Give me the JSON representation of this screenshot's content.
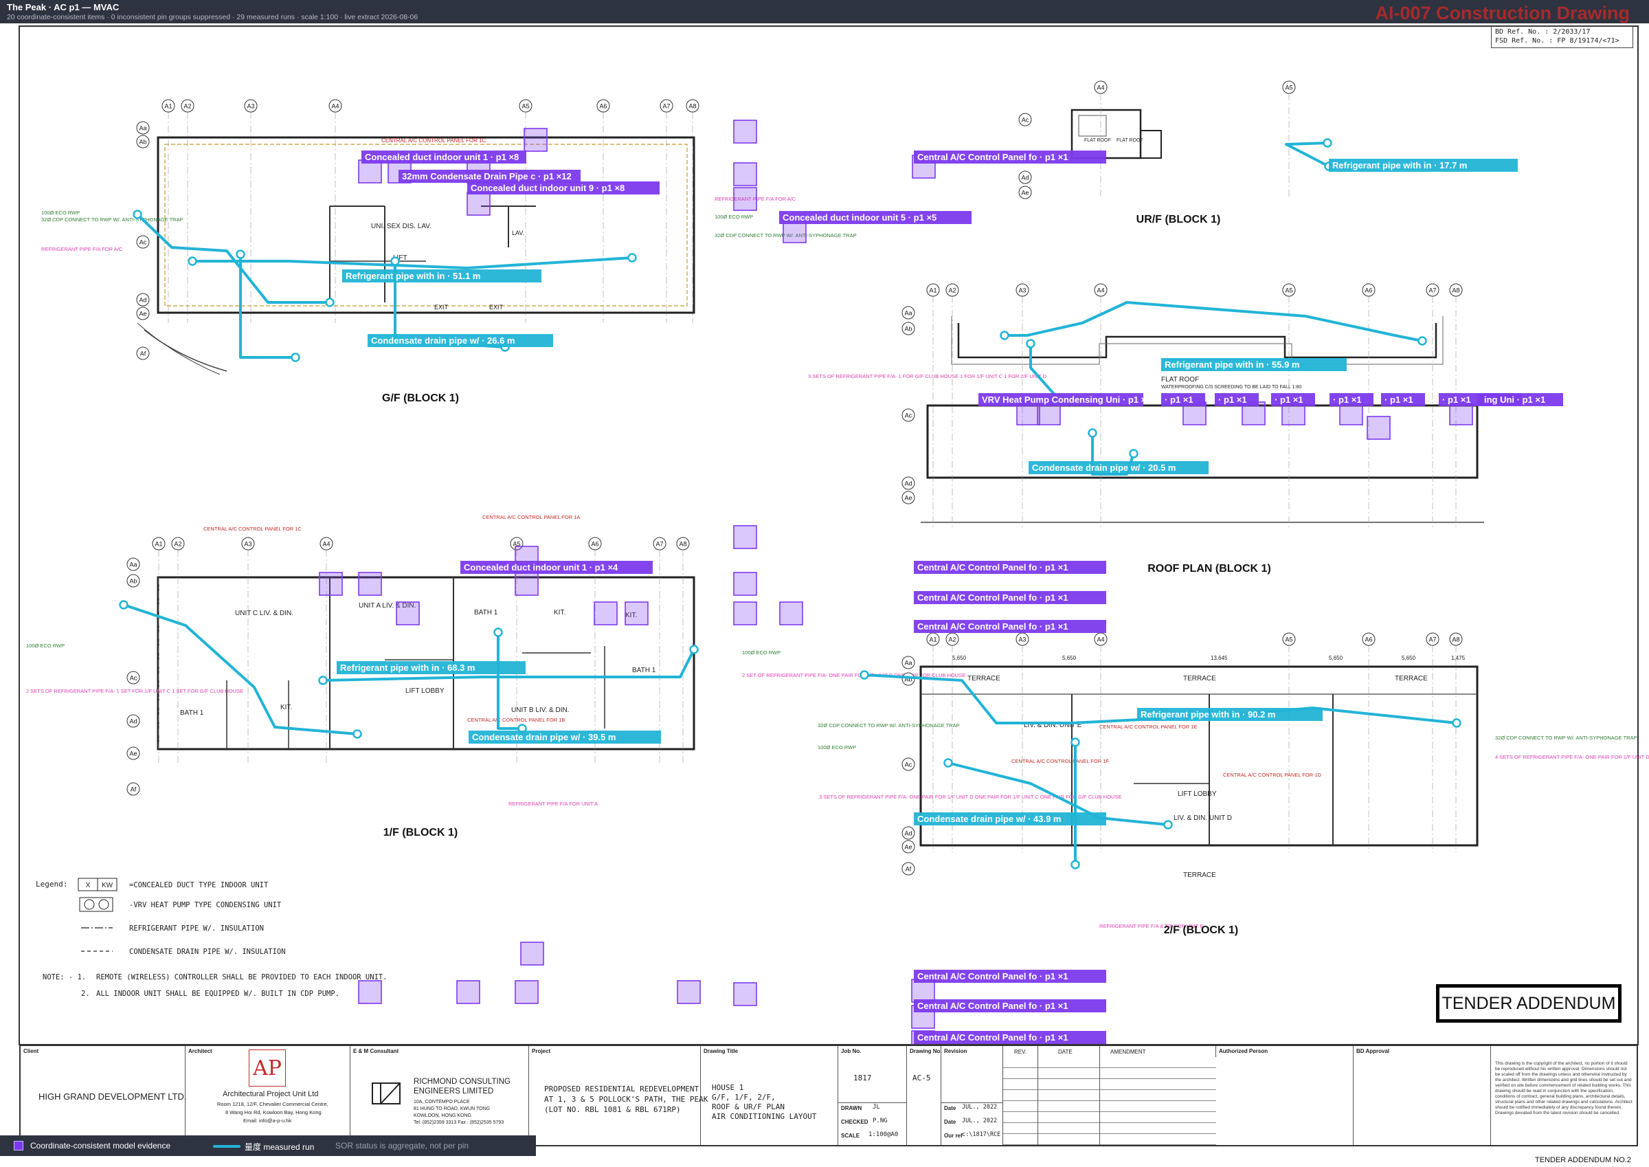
{
  "header": {
    "title": "The Peak · AC p1 — MVAC",
    "subtitle": "20 coordinate-consistent items · 0 inconsistent pin groups suppressed · 29 measured runs · scale 1:100 · live extract 2026-08-06",
    "drawing_tag": "AI-007 Construction Drawing"
  },
  "ref_box": {
    "bd": "BD Ref. No. :  2/2033/17",
    "fsd": "FSD Ref. No. :  FP 8/19174/<71>"
  },
  "colors": {
    "accent_purple": "#7c3aed",
    "accent_cyan": "#22b4d6",
    "header_bg": "#2e3340",
    "tag_red": "#c62828"
  },
  "plans": {
    "gf": {
      "title": "G/F (BLOCK 1)",
      "grid_top": [
        "A1",
        "A2",
        "A3",
        "A4",
        "A5",
        "A6",
        "A7",
        "A8"
      ],
      "grid_side": [
        "Aa",
        "Ab",
        "Ac",
        "Ad",
        "Ae",
        "Af"
      ],
      "room1": "UNI. SEX DIS. LAV.",
      "room2": "LIFT",
      "room3": "LAV.",
      "room4": "EXIT",
      "room5": "EXIT"
    },
    "urf": {
      "title": "UR/F (BLOCK 1)",
      "grid_top": [
        "A4",
        "A5"
      ],
      "grid_side": [
        "Ac",
        "Ad",
        "Ae"
      ],
      "room1": "FLAT ROOF",
      "room2": "FLAT ROOF"
    },
    "roof": {
      "title": "ROOF PLAN (BLOCK 1)",
      "grid_top": [
        "A1",
        "A2",
        "A3",
        "A4",
        "A5",
        "A6",
        "A7",
        "A8"
      ],
      "grid_side": [
        "Aa",
        "Ab",
        "Ac",
        "Ad",
        "Ae"
      ],
      "room1": "FLAT ROOF",
      "note": "WATERPROOFING C/S SCREEDING TO BE LAID TO FALL 1:80"
    },
    "f1": {
      "title": "1/F (BLOCK 1)",
      "grid_top": [
        "A1",
        "A2",
        "A3",
        "A4",
        "A5",
        "A6",
        "A7",
        "A8"
      ],
      "grid_side": [
        "Aa",
        "Ab",
        "Ac",
        "Ad",
        "Ae",
        "Af"
      ],
      "room1": "UNIT C LIV. & DIN.",
      "room2": "UNIT A LIV. & DIN.",
      "room3": "BATH 1",
      "room4": "KIT.",
      "room5": "KIT.",
      "room6": "BATH 1",
      "room7": "KIT.",
      "room8": "UNIT B LIV. & DIN.",
      "room9": "BATH 1",
      "room10": "LIFT LOBBY"
    },
    "f2": {
      "title": "2/F (BLOCK 1)",
      "grid_top": [
        "A1",
        "A2",
        "A3",
        "A4",
        "A5",
        "A6",
        "A7",
        "A8"
      ],
      "grid_side": [
        "Aa",
        "Ab",
        "Ac",
        "Ad",
        "Ae",
        "Af"
      ],
      "room1": "TERRACE",
      "room2": "TERRACE",
      "room3": "TERRACE",
      "room4": "LIV. & DIN. UNIT E",
      "room5": "LIV. & DIN. UNIT D",
      "room6": "LIFT LOBBY",
      "room7": "TERRACE",
      "dims": [
        "5,650",
        "5,650",
        "13,645",
        "5,650",
        "5,650",
        "1,475"
      ]
    }
  },
  "notes_red": {
    "n1": "CENTRAL A/C CONTROL PANEL FOR 1C",
    "n2": "CENTRAL A/C CONTROL PANEL FOR 1A",
    "n3": "CENTRAL A/C CONTROL PANEL FOR 1B",
    "n4": "CENTRAL A/C CONTROL PANEL FOR 1F",
    "n5": "CENTRAL A/C CONTROL PANEL FOR 1D",
    "n6": "CENTRAL A/C CONTROL PANEL FOR 1E"
  },
  "notes_magenta": {
    "m1": "REFRIGERANT PIPE F/A FOR A/C",
    "m2": "2 SETS OF REFRIGERANT PIPE F/A- 1 SET FOR 1/F UNIT C 1 SET FOR G/F CLUB HOUSE",
    "m3": "2 SET OF REFRIGERANT PIPE F/A- ONE PAIR FOR 1/F UNIT B ONE PAIR FOR CLUB HOUSE",
    "m4": "REFRIGERANT PIPE F/A FOR UNIT A",
    "m5": "3 SETS OF REFRIGERANT PIPE F/A- 1 FOR G/F CLUB HOUSE 1 FOR 1/F UNIT C 1 FOR 2/F UNIT D",
    "m6": "3 SETS OF REFRIGERANT PIPE F/A- ONE PAIR FOR 1/F UNIT D ONE PAIR FOR 1/F UNIT C ONE PAIR FOR G/F CLUB HOUSE",
    "m7": "REFRIGERANT PIPE F/A & T/B FOR UNIT E",
    "m8": "4 SETS OF REFRIGERANT PIPE F/A- ONE PAIR FOR 1/F UNIT D ONE PAIR FOR 1/F UNIT E ONE PAIR FOR 1/F UNIT B ONE PAIR FOR G/F CLUB HOUSE"
  },
  "notes_green": {
    "g1": "100Ø ECO RWP",
    "g2": "32Ø CDP CONNECT TO RWP W/. ANTI-SYPHONAGE TRAP",
    "g3": "100Ø ECO RWP",
    "g4": "32Ø CDP CONNECT TO RWP W/. ANTI-SYPHONAGE TRAP"
  },
  "overlay_labels": [
    "Concealed duct indoor unit 1 · p1 ×8",
    "32mm Condensate Drain Pipe c · p1 ×12",
    "Concealed duct indoor unit 9 · p1 ×8",
    "Concealed duct indoor unit 5 · p1 ×5",
    "Central A/C Control Panel fo · p1 ×1",
    "Refrigerant pipe with in · 17.7 m",
    "Refrigerant pipe with in · 51.1 m",
    "Condensate drain pipe w/ · 26.6 m",
    "Refrigerant pipe with in · 55.9 m",
    "VRV Heat Pump Condensing Uni · p1 ×1",
    "· p1 ×1",
    "· p1 ×1",
    "· p1 ×1",
    "· p1 ×1",
    "· p1 ×1",
    "· p1 ×1",
    "· p1 ×1",
    "ing Uni · p1 ×1",
    "Condensate drain pipe w/ · 20.5 m",
    "Concealed duct indoor unit 1 · p1 ×4",
    "Central A/C Control Panel fo · p1 ×1",
    "Central A/C Control Panel fo · p1 ×1",
    "Central A/C Control Panel fo · p1 ×1",
    "Refrigerant pipe with in · 68.3 m",
    "Condensate drain pipe w/ · 39.5 m",
    "Refrigerant pipe with in · 90.2 m",
    "Condensate drain pipe w/ · 43.9 m",
    "Central A/C Control Panel fo · p1 ×1",
    "Central A/C Control Panel fo · p1 ×1",
    "Central A/C Control Panel fo · p1 ×1"
  ],
  "legend_drawing": {
    "heading": "Legend:",
    "sym1_a": "X",
    "sym1_b": "KW",
    "item1": "=CONCEALED DUCT TYPE INDOOR UNIT",
    "item2": "-VRV HEAT PUMP TYPE CONDENSING UNIT",
    "item3": "REFRIGERANT PIPE W/. INSULATION",
    "item4": "CONDENSATE DRAIN PIPE W/. INSULATION",
    "note_head": "NOTE: -  1.",
    "note1": "REMOTE (WIRELESS) CONTROLLER SHALL BE PROVIDED TO EACH INDOOR UNIT.",
    "note2_num": "2.",
    "note2": "ALL INDOOR UNIT SHALL BE EQUIPPED W/. BUILT IN CDP PUMP."
  },
  "stamp": "TENDER ADDENDUM",
  "title_block": {
    "client_cap": "Client",
    "client": "HIGH GRAND DEVELOPMENT LTD.",
    "architect_cap": "Architect",
    "architect_logo": "AP",
    "architect": "Architectural Project Unit Ltd",
    "architect_addr1": "Room 1218, 12/F, Chevalier Commercial Centre,",
    "architect_addr2": "8 Wang Hoi Rd, Kowloon Bay, Hong Kong",
    "architect_email": "Email: info@a-p-u.hk",
    "consultant_cap": "E & M Consultant",
    "consultant_1": "RICHMOND CONSULTING",
    "consultant_2": "ENGINEERS LIMITED",
    "consultant_addr1": "10A, CONTEMPO PLACE",
    "consultant_addr2": "81 HUNG TO ROAD, KWUN TONG",
    "consultant_addr3": "KOWLOON, HONG KONG",
    "consultant_tel": "Tel: (852)2359 3313  Fax : (852)2535 5793",
    "project_cap": "Project",
    "project_1": "PROPOSED RESIDENTIAL REDEVELOPMENT",
    "project_2": "AT 1, 3 & 5 POLLOCK'S PATH, THE PEAK",
    "project_3": "(LOT NO. RBL 1081 & RBL 671RP)",
    "dtitle_cap": "Drawing Title",
    "dtitle_1": "HOUSE 1",
    "dtitle_2": "G/F, 1/F, 2/F,",
    "dtitle_3": "ROOF & UR/F PLAN",
    "dtitle_4": "AIR CONDITIONING LAYOUT",
    "job_cap": "Job No.",
    "job": "1817",
    "dno_cap": "Drawing No.",
    "dno": "AC-5",
    "rev_cap": "Revision",
    "drawn_cap": "DRAWN",
    "drawn": "JL",
    "checked_cap": "CHECKED",
    "checked": "P.NG",
    "scale_cap": "SCALE",
    "scale": "1:100@A0",
    "date_cap": "Date",
    "date1": "JUL., 2022",
    "date2": "JUL., 2022",
    "ourref_cap": "Our ref",
    "ourref": "c:\\1817\\RCE",
    "rev_h": "REV.",
    "date_h": "DATE",
    "amend_h": "AMENDMENT",
    "auth_cap": "Authorized Person",
    "bd_cap": "BD Approval",
    "disclaimer": "This drawing is the copyright of the architect, no portion of it should be reproduced without his written approval. Dimensions should not be scaled off from the drawings unless and otherwise instructed by the architect. Written dimensions and grid lines should be set out and verified on site before commencement of related building works. This drawing should be read in conjunction with the specification, conditions of contract, general building plans, architectural details, structural plans and other related drawings and calculations. Architect should be notified immediately of any discrepancy found therein. Drawings deviated from the latest revision should be cancelled."
  },
  "footer": {
    "addendum": "TENDER ADDENDUM NO.2"
  },
  "overlay_legend": {
    "item1": "Coordinate-consistent model evidence",
    "item2": "量度 measured run",
    "item3": "SOR status is aggregate, not per pin"
  }
}
